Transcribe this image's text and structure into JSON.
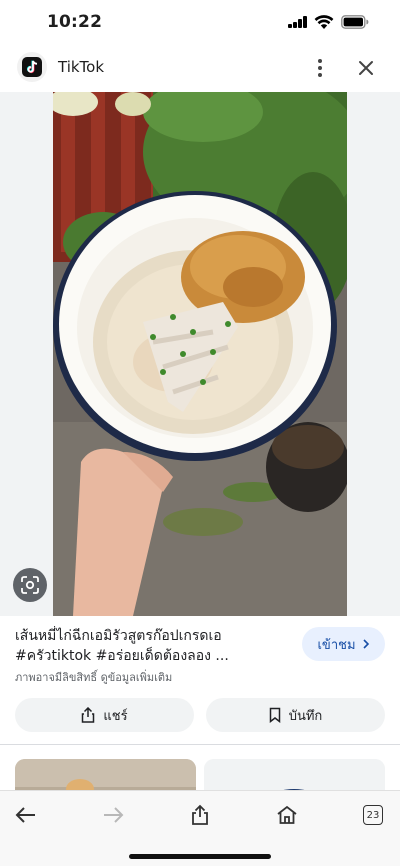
{
  "status_bar": {
    "time": "10:22"
  },
  "header": {
    "source_name": "TikTok"
  },
  "result": {
    "caption_line_1": "เส้นหมี่ไก่ฉีกเอมิรัวสูตรก๊อปเกรดเอ",
    "caption_line_2": "#ครัวtiktok #อร่อยเด็ดต้องลอง ...",
    "copyright_note": "ภาพอาจมีลิขสิทธิ์ ดูข้อมูลเพิ่มเติม",
    "visit_label": "เข้าชม",
    "share_label": "แชร์",
    "save_label": "บันทึก"
  },
  "toolbar": {
    "tab_count": "23"
  },
  "colors": {
    "accent_blue": "#174ea6",
    "visit_bg": "#e8f0fe",
    "pill_bg": "#f1f3f4"
  }
}
